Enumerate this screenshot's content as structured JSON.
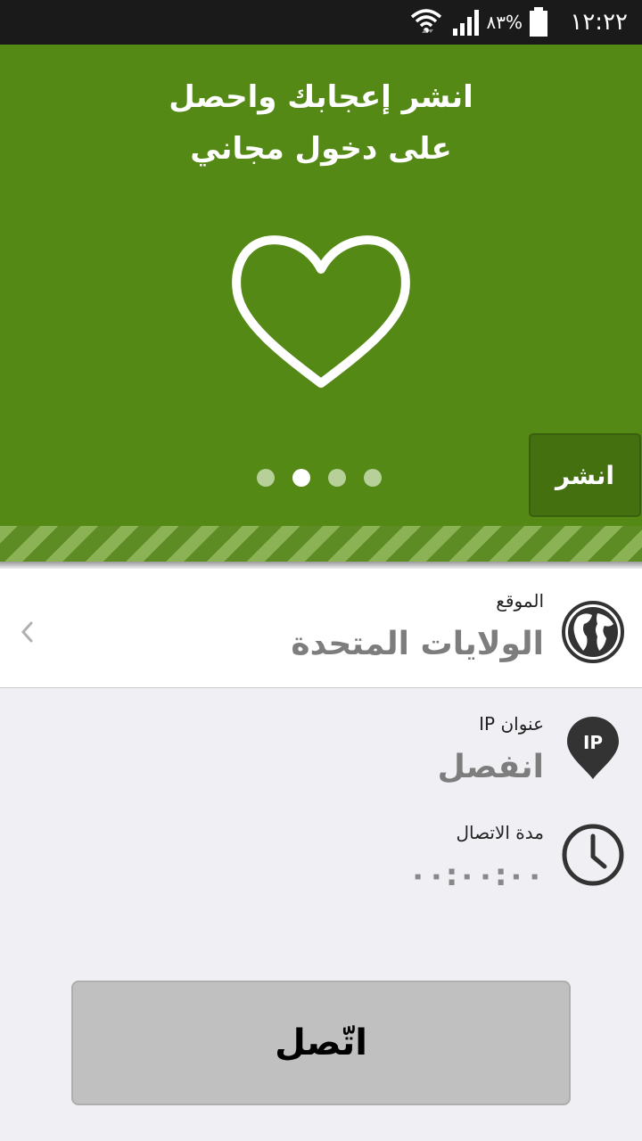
{
  "status_bar": {
    "time": "١٢:٢٢",
    "battery": "٨٣%",
    "icons": [
      "wifi-icon",
      "signal-icon",
      "battery-icon"
    ]
  },
  "promo": {
    "title_line1": "انشر إعجابك واحصل",
    "title_line2": "على دخول مجاني",
    "share_label": "انشر",
    "page_count": 4,
    "active_page": 2,
    "background_color": "#548915"
  },
  "location": {
    "label": "الموقع",
    "value": "الولايات المتحدة"
  },
  "ip": {
    "label": "عنوان IP",
    "value": "انفصل",
    "icon_text": "IP"
  },
  "duration": {
    "label": "مدة الاتصال",
    "value": "٠٠:٠٠:٠٠"
  },
  "connect": {
    "label": "اتّصل"
  }
}
